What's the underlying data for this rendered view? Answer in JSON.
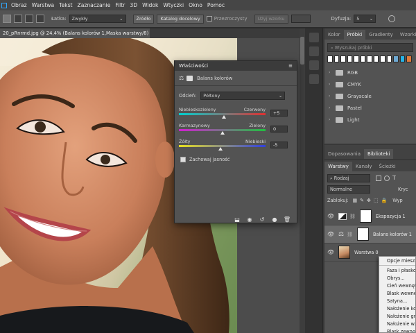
{
  "menu": [
    "Obraz",
    "Warstwa",
    "Tekst",
    "Zaznaczanie",
    "Filtr",
    "3D",
    "Widok",
    "Wtyczki",
    "Okno",
    "Pomoc"
  ],
  "options_bar": {
    "latka_label": "Łatka:",
    "latka_value": "Zwykły",
    "zrodlo": "Źródło",
    "katalog": "Katalog docelowy",
    "przezroczysty": "Przezroczysty",
    "uzyj_wzorku": "Użyj wzorku",
    "dyfuzja_label": "Dyfuzja:",
    "dyfuzja_value": "5"
  },
  "document_tab": "20_pRnrmd.jpg @ 24,4% (Balans kolorów 1,Maska warstwy/8) *",
  "properties": {
    "title": "Właściwości",
    "subtitle": "Balans kolorów",
    "tone_label": "Odcień:",
    "tone_value": "Półtony",
    "sliders": [
      {
        "left": "Niebieskozielony",
        "right": "Czerwony",
        "value": "+5",
        "pos": 0.52
      },
      {
        "left": "Karmazynowy",
        "right": "Zielony",
        "value": "0",
        "pos": 0.5
      },
      {
        "left": "Żółty",
        "right": "Niebieski",
        "value": "-5",
        "pos": 0.48
      }
    ],
    "preserve_luminosity": "Zachowaj jasność"
  },
  "swatches_panel": {
    "tabs": [
      "Kolor",
      "Próbki",
      "Gradienty",
      "Wzorki"
    ],
    "search_placeholder": "Wyszukaj próbki",
    "swatches": [
      "#ffffff",
      "#ffffff",
      "#ffffff",
      "#ffffff",
      "#ffffff",
      "#ffffff",
      "#ffffff",
      "#ffffff",
      "#ffffff",
      "#ffffff",
      "#6fa9d2",
      "#26b3e6",
      "#e07a3a"
    ],
    "folders": [
      "RGB",
      "CMYK",
      "Grayscale",
      "Pastel",
      "Light"
    ]
  },
  "library_tabs": [
    "Dopasowania",
    "Biblioteki"
  ],
  "layers_panel": {
    "tabs": [
      "Warstwy",
      "Kanały",
      "Ścieżki"
    ],
    "filter": "Rodzaj",
    "blend_mode": "Normalne",
    "opacity_label": "Kryc",
    "lock_label": "Zablokuj:",
    "fill_label": "Wyp",
    "layers": [
      {
        "name": "Ekspozycja 1",
        "selected": false
      },
      {
        "name": "Balans kolorów 1",
        "selected": true
      },
      {
        "name": "Warstwa 0",
        "selected": false
      }
    ]
  },
  "context_menu": [
    "Opcje miesza",
    "Faza i płasko",
    "Obrys...",
    "Cień wewnętr",
    "Blask wewnętr",
    "Satyna...",
    "Nałożenie ko",
    "Nałożenie gra",
    "Nałożenie wz",
    "Blask zewnęt"
  ]
}
